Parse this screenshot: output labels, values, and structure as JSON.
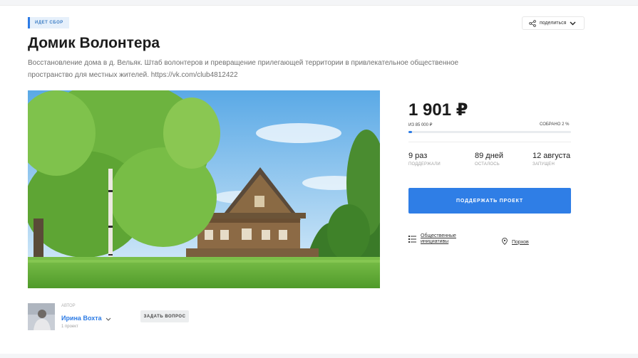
{
  "badge": "ИДЕТ СБОР",
  "share": {
    "label": "поделиться"
  },
  "project": {
    "title": "Домик Волонтера",
    "description": "Восстановление дома в д. Вельяк. Штаб волонтеров и превращение прилегающей территории в привлекательное общественное пространство для местных жителей. https://vk.com/club4812422"
  },
  "funding": {
    "amount": "1 901 ₽",
    "goal": "ИЗ 85 000 ₽",
    "percent_label": "СОБРАНО 2 %",
    "progress": 0.02
  },
  "stats": [
    {
      "value": "9 раз",
      "label": "ПОДДЕРЖАЛИ"
    },
    {
      "value": "89 дней",
      "label": "ОСТАЛОСЬ"
    },
    {
      "value": "12 августа",
      "label": "ЗАПУЩЕН"
    }
  ],
  "support_button": "ПОДДЕРЖАТЬ ПРОЕКТ",
  "category": {
    "line1": "Общественные",
    "line2": "инициативы",
    "icon": "list-icon"
  },
  "location": {
    "label": "Порхов",
    "icon": "map-pin-icon"
  },
  "author": {
    "label": "АВТОР",
    "name": "Ирина Вохта",
    "projects": "1 проект"
  },
  "ask_button": "ЗАДАТЬ ВОПРОС",
  "colors": {
    "accent": "#2f7ee6",
    "badge_bg": "#e6f0fb"
  }
}
